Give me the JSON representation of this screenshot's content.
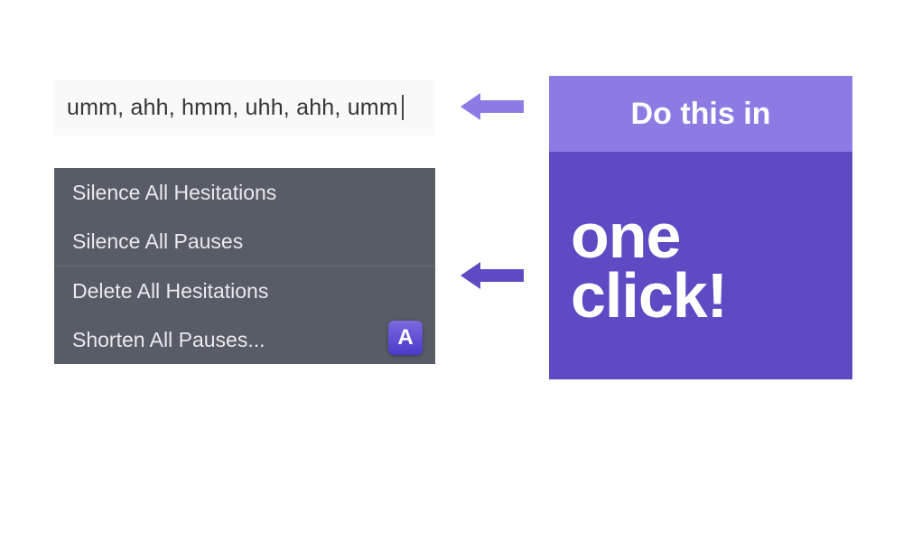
{
  "input": {
    "text": "umm, ahh, hmm, uhh, ahh, umm"
  },
  "menu": {
    "items": [
      {
        "label": "Silence All Hesitations"
      },
      {
        "label": "Silence All Pauses"
      },
      {
        "label": "Delete All Hesitations"
      },
      {
        "label": "Shorten All Pauses..."
      }
    ]
  },
  "badge": {
    "letter": "A"
  },
  "callout": {
    "header": "Do this in",
    "body": "one click!"
  },
  "colors": {
    "menu_bg": "#575c66",
    "callout_bg": "#5f4ac4",
    "callout_header_bg": "#8d7ae3",
    "arrow": "#6a58cf"
  }
}
